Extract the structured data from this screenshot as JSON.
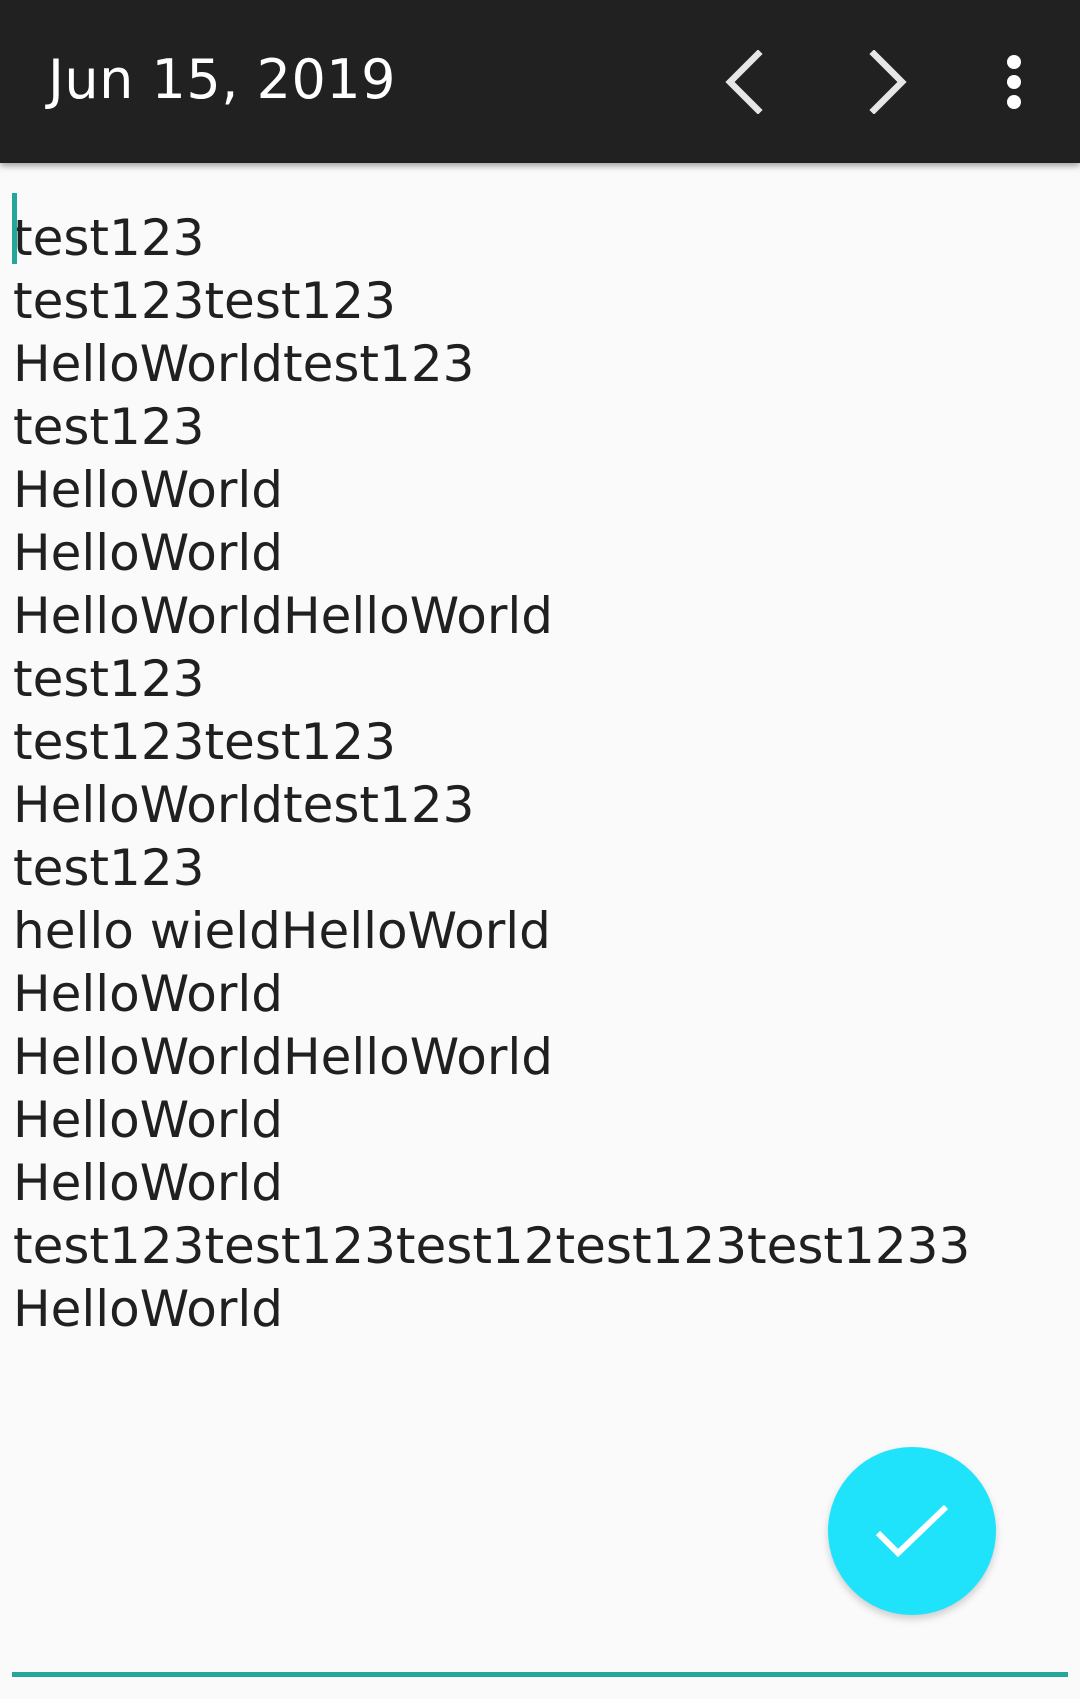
{
  "toolbar": {
    "title": "Jun 15, 2019",
    "prev_icon": "chevron-left-icon",
    "next_icon": "chevron-right-icon",
    "more_icon": "more-vert-icon"
  },
  "editor": {
    "lines": [
      "test123",
      "test123test123",
      "HelloWorldtest123",
      "test123",
      "HelloWorld",
      "HelloWorld",
      "HelloWorldHelloWorld",
      "test123",
      "test123test123",
      "HelloWorldtest123",
      "test123",
      "hello wieldHelloWorld",
      "HelloWorld",
      "HelloWorldHelloWorld",
      "HelloWorld",
      "HelloWorld",
      "test123test123test12test123test1233",
      "HelloWorld"
    ]
  },
  "fab": {
    "icon": "check-icon"
  },
  "colors": {
    "toolbar_bg": "#212121",
    "accent": "#26a69a",
    "fab": "#1ee3fa",
    "background": "#fafafa"
  }
}
